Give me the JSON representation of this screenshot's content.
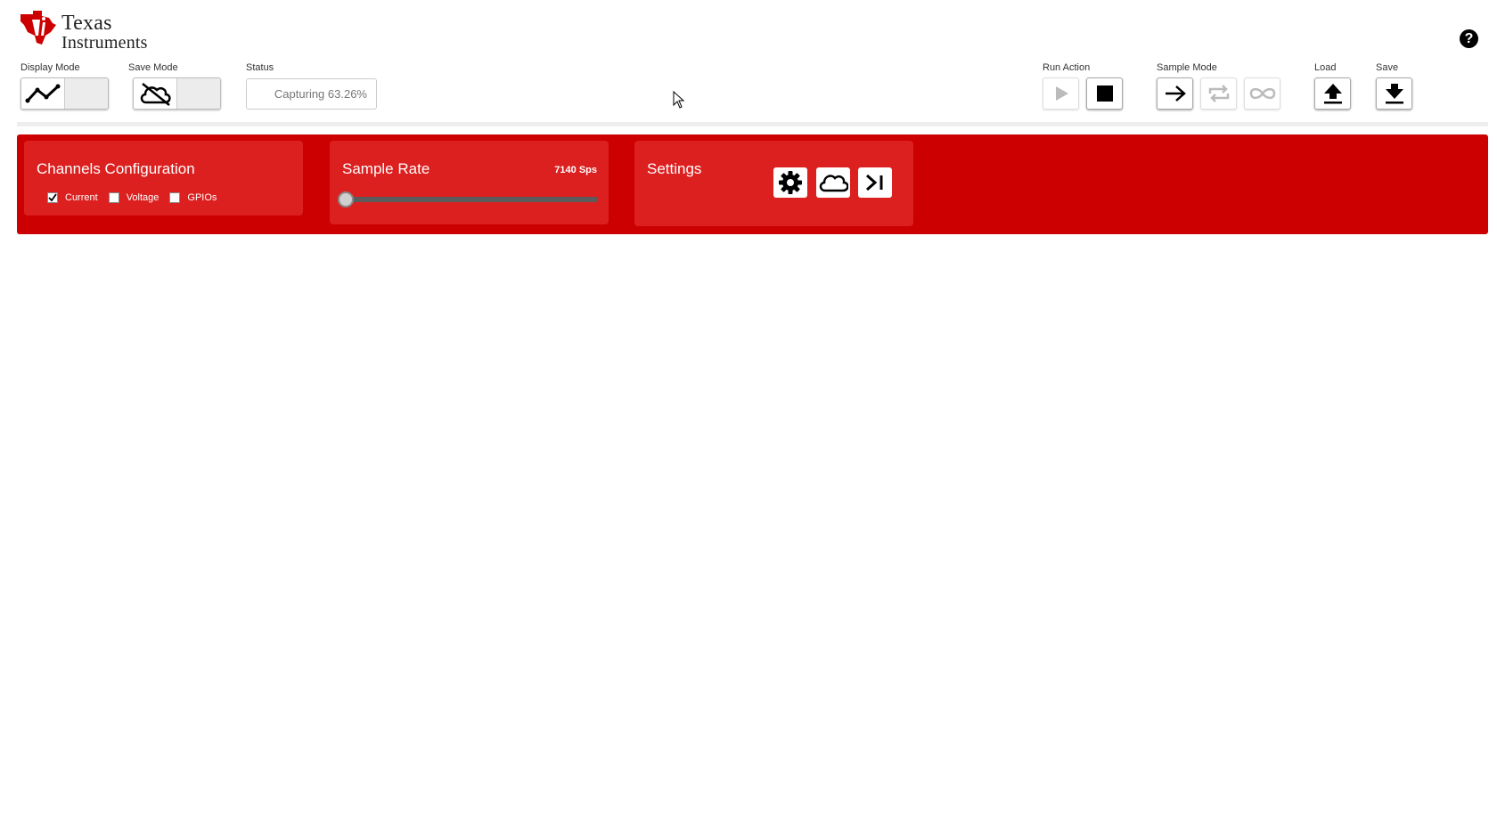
{
  "brand": {
    "line1": "Texas",
    "line2": "Instruments",
    "brand_color": "#cc0000"
  },
  "help": {
    "label": "?"
  },
  "toolbar": {
    "display_mode_label": "Display Mode",
    "save_mode_label": "Save Mode",
    "status_label": "Status",
    "status_text": "Capturing 63.26%",
    "run_action_label": "Run Action",
    "sample_mode_label": "Sample Mode",
    "load_label": "Load",
    "save_label": "Save"
  },
  "icons": {
    "display_mode": "line-chart-icon",
    "save_mode": "cloud-off-icon",
    "run": "play-icon",
    "stop": "stop-icon",
    "sample_single": "arrow-right-icon",
    "sample_repeat": "repeat-icon",
    "sample_infinite": "infinity-icon",
    "load": "upload-icon",
    "save": "download-icon",
    "settings_gear": "gear-icon",
    "settings_cloud": "cloud-icon",
    "settings_skip": "skip-to-end-icon"
  },
  "channels": {
    "title": "Channels Configuration",
    "items": [
      {
        "label": "Current",
        "checked": true
      },
      {
        "label": "Voltage",
        "checked": false
      },
      {
        "label": "GPIOs",
        "checked": false
      }
    ]
  },
  "sample_rate": {
    "title": "Sample Rate",
    "value_text": "7140 Sps",
    "slider_fraction": 0.0
  },
  "settings": {
    "title": "Settings"
  },
  "colors": {
    "red_bar": "#cc0000",
    "panel": "#dc1f1f"
  }
}
